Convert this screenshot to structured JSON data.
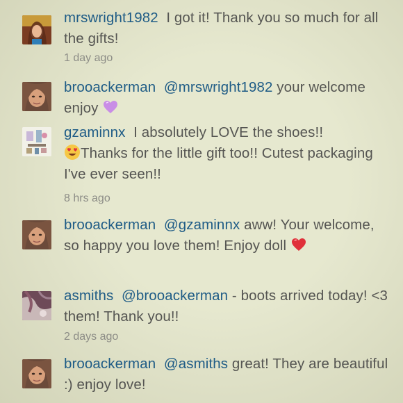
{
  "comments": [
    {
      "user": "mrswright1982",
      "parts": [
        "I got it! Thank you so much for all the gifts!"
      ],
      "time": "1 day ago",
      "avatar_icon": "profile-photo-mrswright1982"
    },
    {
      "user": "brooackerman",
      "mention": "@mrswright1982",
      "parts": [
        " your welcome enjoy "
      ],
      "emoji": "purple-heart-icon",
      "avatar_icon": "profile-photo-brooackerman"
    },
    {
      "user": "gzaminnx",
      "parts": [
        "I absolutely LOVE the shoes!!",
        "Thanks for the little gift too!! Cutest packaging I've ever seen!!"
      ],
      "emoji": "heart-eyes-smiley-icon",
      "time": "8 hrs ago",
      "avatar_icon": "profile-photo-gzaminnx"
    },
    {
      "user": "brooackerman",
      "mention": "@gzaminnx",
      "parts": [
        " aww! Your welcome, so happy you love them! Enjoy doll "
      ],
      "emoji": "red-heart-icon",
      "avatar_icon": "profile-photo-brooackerman"
    },
    {
      "user": "asmiths",
      "mention": "@brooackerman",
      "parts": [
        " - boots arrived today! <3 them! Thank you!!"
      ],
      "time": "2 days ago",
      "avatar_icon": "profile-photo-asmiths"
    },
    {
      "user": "brooackerman",
      "mention": "@asmiths",
      "parts": [
        " great! They are beautiful :) enjoy love!"
      ],
      "avatar_icon": "profile-photo-brooackerman"
    }
  ],
  "colors": {
    "background": "#e6e8cf",
    "username": "#1f5c86",
    "body_text": "#555552",
    "timestamp": "#8c8c86"
  }
}
